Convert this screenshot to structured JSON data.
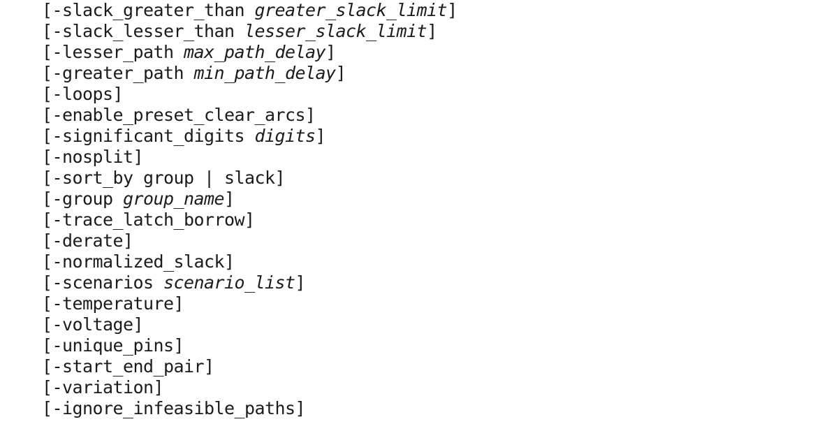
{
  "document": {
    "kind": "command-line-options-synopsis",
    "text_color": "#1b1b1b",
    "background_color": "#ffffff",
    "lines": [
      {
        "index": 1,
        "full_text": "[-slack_greater_than greater_slack_limit]",
        "option": "-slack_greater_than",
        "argument": "greater_slack_limit",
        "prefix": "[-slack_greater_than ",
        "italic": "greater_slack_limit",
        "suffix": "]"
      },
      {
        "index": 2,
        "full_text": "[-slack_lesser_than lesser_slack_limit]",
        "option": "-slack_lesser_than",
        "argument": "lesser_slack_limit",
        "prefix": "[-slack_lesser_than ",
        "italic": "lesser_slack_limit",
        "suffix": "]"
      },
      {
        "index": 3,
        "full_text": "[-lesser_path max_path_delay]",
        "option": "-lesser_path",
        "argument": "max_path_delay",
        "prefix": "[-lesser_path ",
        "italic": "max_path_delay",
        "suffix": "]"
      },
      {
        "index": 4,
        "full_text": "[-greater_path min_path_delay]",
        "option": "-greater_path",
        "argument": "min_path_delay",
        "prefix": "[-greater_path ",
        "italic": "min_path_delay",
        "suffix": "]"
      },
      {
        "index": 5,
        "full_text": "[-loops]",
        "option": "-loops",
        "argument": "",
        "prefix": "[-loops",
        "italic": "",
        "suffix": "]"
      },
      {
        "index": 6,
        "full_text": "[-enable_preset_clear_arcs]",
        "option": "-enable_preset_clear_arcs",
        "argument": "",
        "prefix": "[-enable_preset_clear_arcs",
        "italic": "",
        "suffix": "]"
      },
      {
        "index": 7,
        "full_text": "[-significant_digits digits]",
        "option": "-significant_digits",
        "argument": "digits",
        "prefix": "[-significant_digits ",
        "italic": "digits",
        "suffix": "]"
      },
      {
        "index": 8,
        "full_text": "[-nosplit]",
        "option": "-nosplit",
        "argument": "",
        "prefix": "[-nosplit",
        "italic": "",
        "suffix": "]"
      },
      {
        "index": 9,
        "full_text": "[-sort_by group | slack]",
        "option": "-sort_by",
        "argument": "group | slack",
        "prefix": "[-sort_by group | slack",
        "italic": "",
        "suffix": "]"
      },
      {
        "index": 10,
        "full_text": "[-group group_name]",
        "option": "-group",
        "argument": "group_name",
        "prefix": "[-group ",
        "italic": "group_name",
        "suffix": "]"
      },
      {
        "index": 11,
        "full_text": "[-trace_latch_borrow]",
        "option": "-trace_latch_borrow",
        "argument": "",
        "prefix": "[-trace_latch_borrow",
        "italic": "",
        "suffix": "]"
      },
      {
        "index": 12,
        "full_text": "[-derate]",
        "option": "-derate",
        "argument": "",
        "prefix": "[-derate",
        "italic": "",
        "suffix": "]"
      },
      {
        "index": 13,
        "full_text": "[-normalized_slack]",
        "option": "-normalized_slack",
        "argument": "",
        "prefix": "[-normalized_slack",
        "italic": "",
        "suffix": "]"
      },
      {
        "index": 14,
        "full_text": "[-scenarios scenario_list]",
        "option": "-scenarios",
        "argument": "scenario_list",
        "prefix": "[-scenarios ",
        "italic": "scenario_list",
        "suffix": "]"
      },
      {
        "index": 15,
        "full_text": "[-temperature]",
        "option": "-temperature",
        "argument": "",
        "prefix": "[-temperature",
        "italic": "",
        "suffix": "]"
      },
      {
        "index": 16,
        "full_text": "[-voltage]",
        "option": "-voltage",
        "argument": "",
        "prefix": "[-voltage",
        "italic": "",
        "suffix": "]"
      },
      {
        "index": 17,
        "full_text": "[-unique_pins]",
        "option": "-unique_pins",
        "argument": "",
        "prefix": "[-unique_pins",
        "italic": "",
        "suffix": "]"
      },
      {
        "index": 18,
        "full_text": "[-start_end_pair]",
        "option": "-start_end_pair",
        "argument": "",
        "prefix": "[-start_end_pair",
        "italic": "",
        "suffix": "]"
      },
      {
        "index": 19,
        "full_text": "[-variation]",
        "option": "-variation",
        "argument": "",
        "prefix": "[-variation",
        "italic": "",
        "suffix": "]"
      },
      {
        "index": 20,
        "full_text": "[-ignore_infeasible_paths]",
        "option": "-ignore_infeasible_paths",
        "argument": "",
        "prefix": "[-ignore_infeasible_paths",
        "italic": "",
        "suffix": "]"
      }
    ]
  }
}
